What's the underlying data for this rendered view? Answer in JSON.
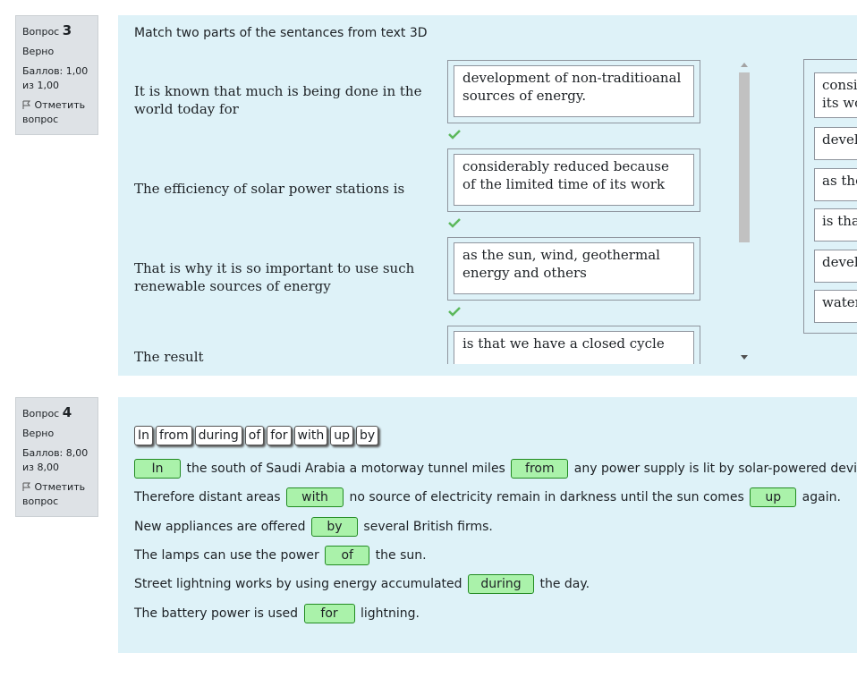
{
  "q3": {
    "info": {
      "label": "Вопрос",
      "number": "3",
      "state": "Верно",
      "grade": "Баллов: 1,00 из 1,00",
      "flag": "Отметить вопрос"
    },
    "qtext": "Match two parts of the sentances from text 3D",
    "rows": [
      {
        "stem": "It is known that much is being done in the world today for",
        "answer": "development of non-traditioanal sources of energy.",
        "correct": true
      },
      {
        "stem": "The efficiency of solar power stations is",
        "answer": "considerably reduced because of the limited time of its work",
        "correct": true
      },
      {
        "stem": "That is why it is so important to use such renewable sources of energy",
        "answer": "as the sun, wind, geothermal energy and others",
        "correct": true
      },
      {
        "stem": "The result",
        "answer": "is that we have a closed cycle"
      }
    ],
    "choices": [
      "consic its wo",
      "develo",
      "as the",
      "is that",
      "develo",
      "water"
    ]
  },
  "q4": {
    "info": {
      "label": "Вопрос",
      "number": "4",
      "state": "Верно",
      "grade": "Баллов: 8,00 из 8,00",
      "flag": "Отметить вопрос"
    },
    "chips": [
      "In",
      "from",
      "during",
      "of",
      "for",
      "with",
      "up",
      "by"
    ],
    "sentences": {
      "s1": {
        "gap1": "In",
        "t1": "the south of Saudi Arabia a motorway tunnel miles",
        "gap2": "from",
        "t2": "any power supply is lit by solar-powered devices."
      },
      "s2": {
        "t0": "Therefore distant areas",
        "gap1": "with",
        "t1": "no source of electricity remain in darkness until the sun comes",
        "gap2": "up",
        "t2": "again."
      },
      "s3": {
        "t0": "New appliances are offered",
        "gap1": "by",
        "t1": "several British firms."
      },
      "s4": {
        "t0": "The lamps can use the power",
        "gap1": "of",
        "t1": "the sun."
      },
      "s5": {
        "t0": "Street lightning works by using energy accumulated",
        "gap1": "during",
        "t1": "the day."
      },
      "s6": {
        "t0": "The battery power is used",
        "gap1": "for",
        "t1": "lightning."
      }
    }
  },
  "colors": {
    "content_bg": "#def2f8",
    "info_bg": "#dee2e6",
    "gap_bg": "#aaf2aa",
    "check": "#5cb85c"
  }
}
